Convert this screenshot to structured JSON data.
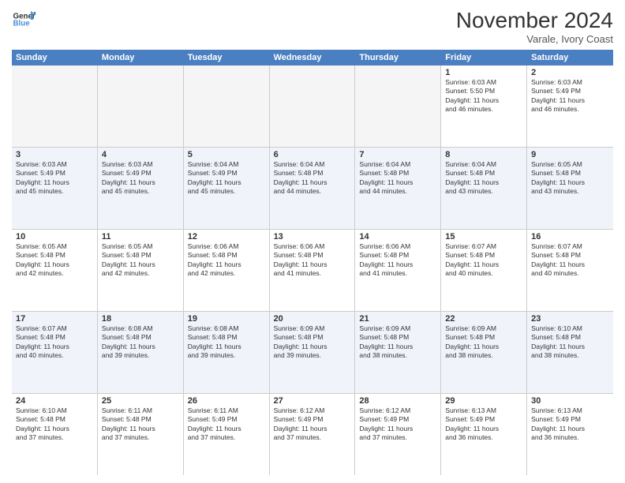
{
  "logo": {
    "line1": "General",
    "line2": "Blue"
  },
  "title": "November 2024",
  "location": "Varale, Ivory Coast",
  "days_of_week": [
    "Sunday",
    "Monday",
    "Tuesday",
    "Wednesday",
    "Thursday",
    "Friday",
    "Saturday"
  ],
  "weeks": [
    {
      "alt": false,
      "cells": [
        {
          "empty": true,
          "day": "",
          "info": ""
        },
        {
          "empty": true,
          "day": "",
          "info": ""
        },
        {
          "empty": true,
          "day": "",
          "info": ""
        },
        {
          "empty": true,
          "day": "",
          "info": ""
        },
        {
          "empty": true,
          "day": "",
          "info": ""
        },
        {
          "empty": false,
          "day": "1",
          "info": "Sunrise: 6:03 AM\nSunset: 5:50 PM\nDaylight: 11 hours\nand 46 minutes."
        },
        {
          "empty": false,
          "day": "2",
          "info": "Sunrise: 6:03 AM\nSunset: 5:49 PM\nDaylight: 11 hours\nand 46 minutes."
        }
      ]
    },
    {
      "alt": true,
      "cells": [
        {
          "empty": false,
          "day": "3",
          "info": "Sunrise: 6:03 AM\nSunset: 5:49 PM\nDaylight: 11 hours\nand 45 minutes."
        },
        {
          "empty": false,
          "day": "4",
          "info": "Sunrise: 6:03 AM\nSunset: 5:49 PM\nDaylight: 11 hours\nand 45 minutes."
        },
        {
          "empty": false,
          "day": "5",
          "info": "Sunrise: 6:04 AM\nSunset: 5:49 PM\nDaylight: 11 hours\nand 45 minutes."
        },
        {
          "empty": false,
          "day": "6",
          "info": "Sunrise: 6:04 AM\nSunset: 5:48 PM\nDaylight: 11 hours\nand 44 minutes."
        },
        {
          "empty": false,
          "day": "7",
          "info": "Sunrise: 6:04 AM\nSunset: 5:48 PM\nDaylight: 11 hours\nand 44 minutes."
        },
        {
          "empty": false,
          "day": "8",
          "info": "Sunrise: 6:04 AM\nSunset: 5:48 PM\nDaylight: 11 hours\nand 43 minutes."
        },
        {
          "empty": false,
          "day": "9",
          "info": "Sunrise: 6:05 AM\nSunset: 5:48 PM\nDaylight: 11 hours\nand 43 minutes."
        }
      ]
    },
    {
      "alt": false,
      "cells": [
        {
          "empty": false,
          "day": "10",
          "info": "Sunrise: 6:05 AM\nSunset: 5:48 PM\nDaylight: 11 hours\nand 42 minutes."
        },
        {
          "empty": false,
          "day": "11",
          "info": "Sunrise: 6:05 AM\nSunset: 5:48 PM\nDaylight: 11 hours\nand 42 minutes."
        },
        {
          "empty": false,
          "day": "12",
          "info": "Sunrise: 6:06 AM\nSunset: 5:48 PM\nDaylight: 11 hours\nand 42 minutes."
        },
        {
          "empty": false,
          "day": "13",
          "info": "Sunrise: 6:06 AM\nSunset: 5:48 PM\nDaylight: 11 hours\nand 41 minutes."
        },
        {
          "empty": false,
          "day": "14",
          "info": "Sunrise: 6:06 AM\nSunset: 5:48 PM\nDaylight: 11 hours\nand 41 minutes."
        },
        {
          "empty": false,
          "day": "15",
          "info": "Sunrise: 6:07 AM\nSunset: 5:48 PM\nDaylight: 11 hours\nand 40 minutes."
        },
        {
          "empty": false,
          "day": "16",
          "info": "Sunrise: 6:07 AM\nSunset: 5:48 PM\nDaylight: 11 hours\nand 40 minutes."
        }
      ]
    },
    {
      "alt": true,
      "cells": [
        {
          "empty": false,
          "day": "17",
          "info": "Sunrise: 6:07 AM\nSunset: 5:48 PM\nDaylight: 11 hours\nand 40 minutes."
        },
        {
          "empty": false,
          "day": "18",
          "info": "Sunrise: 6:08 AM\nSunset: 5:48 PM\nDaylight: 11 hours\nand 39 minutes."
        },
        {
          "empty": false,
          "day": "19",
          "info": "Sunrise: 6:08 AM\nSunset: 5:48 PM\nDaylight: 11 hours\nand 39 minutes."
        },
        {
          "empty": false,
          "day": "20",
          "info": "Sunrise: 6:09 AM\nSunset: 5:48 PM\nDaylight: 11 hours\nand 39 minutes."
        },
        {
          "empty": false,
          "day": "21",
          "info": "Sunrise: 6:09 AM\nSunset: 5:48 PM\nDaylight: 11 hours\nand 38 minutes."
        },
        {
          "empty": false,
          "day": "22",
          "info": "Sunrise: 6:09 AM\nSunset: 5:48 PM\nDaylight: 11 hours\nand 38 minutes."
        },
        {
          "empty": false,
          "day": "23",
          "info": "Sunrise: 6:10 AM\nSunset: 5:48 PM\nDaylight: 11 hours\nand 38 minutes."
        }
      ]
    },
    {
      "alt": false,
      "cells": [
        {
          "empty": false,
          "day": "24",
          "info": "Sunrise: 6:10 AM\nSunset: 5:48 PM\nDaylight: 11 hours\nand 37 minutes."
        },
        {
          "empty": false,
          "day": "25",
          "info": "Sunrise: 6:11 AM\nSunset: 5:48 PM\nDaylight: 11 hours\nand 37 minutes."
        },
        {
          "empty": false,
          "day": "26",
          "info": "Sunrise: 6:11 AM\nSunset: 5:49 PM\nDaylight: 11 hours\nand 37 minutes."
        },
        {
          "empty": false,
          "day": "27",
          "info": "Sunrise: 6:12 AM\nSunset: 5:49 PM\nDaylight: 11 hours\nand 37 minutes."
        },
        {
          "empty": false,
          "day": "28",
          "info": "Sunrise: 6:12 AM\nSunset: 5:49 PM\nDaylight: 11 hours\nand 37 minutes."
        },
        {
          "empty": false,
          "day": "29",
          "info": "Sunrise: 6:13 AM\nSunset: 5:49 PM\nDaylight: 11 hours\nand 36 minutes."
        },
        {
          "empty": false,
          "day": "30",
          "info": "Sunrise: 6:13 AM\nSunset: 5:49 PM\nDaylight: 11 hours\nand 36 minutes."
        }
      ]
    }
  ]
}
